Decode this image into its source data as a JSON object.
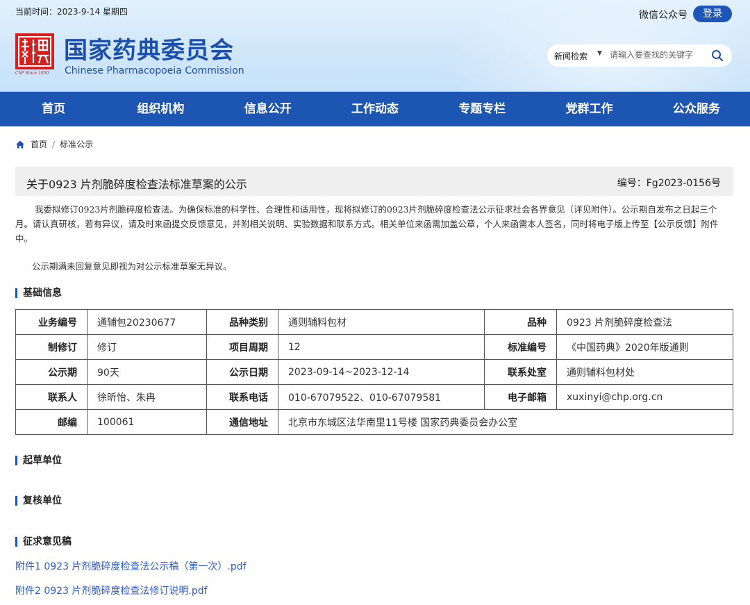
{
  "header": {
    "date_text": "当前时间：2023-9-14 星期四",
    "wechat": "微信公众号",
    "login": "登录",
    "brand_cn": "国家药典委员会",
    "brand_en": "Chinese Pharmacopoeia Commission",
    "seal_caption": "ChP Since 1950",
    "search_scope": "新闻检索",
    "search_placeholder": "请输入要查找的关键字"
  },
  "nav": [
    "首页",
    "组织机构",
    "信息公开",
    "工作动态",
    "专题专栏",
    "党群工作",
    "公众服务"
  ],
  "breadcrumb": {
    "home": "首页",
    "current": "标准公示"
  },
  "article": {
    "title": "关于0923 片剂脆碎度检查法标准草案的公示",
    "number": "编号：Fg2023-0156号",
    "para1": "我委拟修订0923片剂脆碎度检查法。为确保标准的科学性、合理性和适用性，现将拟修订的0923片剂脆碎度检查法公示征求社会各界意见（详见附件）。公示期自发布之日起三个月。请认真研核，若有异议，请及时来函提交反馈意见，并附相关说明、实验数据和联系方式。相关单位来函需加盖公章，个人来函需本人签名，同时将电子版上传至【公示反馈】附件中。",
    "para2": "公示期满未回复意见即视为对公示标准草案无异议。"
  },
  "sections": {
    "basic": "基础信息",
    "draft": "起草单位",
    "review": "复核单位",
    "opinion": "征求意见稿"
  },
  "table": {
    "r1": {
      "k1": "业务编号",
      "v1": "通辅包20230677",
      "k2": "品种类别",
      "v2": "通则辅料包材",
      "k3": "品种",
      "v3": "0923 片剂脆碎度检查法"
    },
    "r2": {
      "k1": "制修订",
      "v1": "修订",
      "k2": "项目周期",
      "v2": "12",
      "k3": "标准编号",
      "v3": "《中国药典》2020年版通则"
    },
    "r3": {
      "k1": "公示期",
      "v1": "90天",
      "k2": "公示日期",
      "v2": "2023-09-14~2023-12-14",
      "k3": "联系处室",
      "v3": "通则辅料包材处"
    },
    "r4": {
      "k1": "联系人",
      "v1": "徐昕怡、朱冉",
      "k2": "联系电话",
      "v2": "010-67079522、010-67079581",
      "k3": "电子邮箱",
      "v3": "xuxinyi@chp.org.cn"
    },
    "r5": {
      "k1": "邮编",
      "v1": "100061",
      "k2": "通信地址",
      "v2": "北京市东城区法华南里11号楼 国家药典委员会办公室"
    }
  },
  "attachments": [
    "附件1 0923 片剂脆碎度检查法公示稿（第一次）.pdf",
    "附件2 0923 片剂脆碎度检查法修订说明.pdf"
  ]
}
